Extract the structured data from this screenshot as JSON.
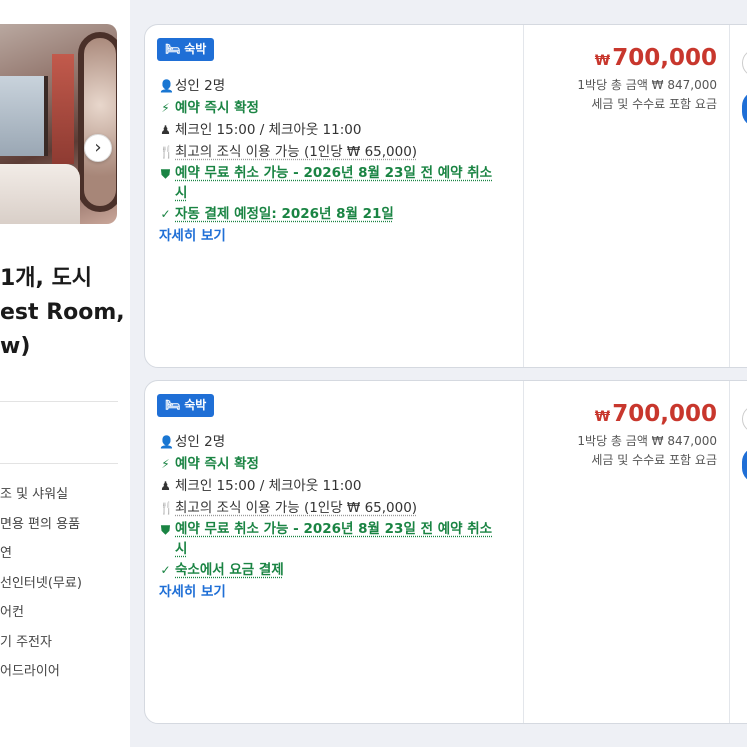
{
  "room": {
    "title_lines": [
      "1개, 도시",
      "est Room,",
      "w)"
    ],
    "amenities": [
      "조 및 샤워실",
      "면용 편의 용품",
      "연",
      "선인터넷(무료)",
      "어컨",
      "기 주전자",
      "어드라이어"
    ],
    "next_glyph": "›"
  },
  "offers": [
    {
      "badge": "숙박",
      "guests": "성인 2명",
      "instant": "예약 즉시 확정",
      "checkin": "체크인 15:00 / 체크아웃 11:00",
      "breakfast": "최고의 조식 이용 가능 (1인당 ₩ 65,000)",
      "cancel": "예약 무료 취소 가능 - 2026년 8월 23일 전 예약 취소 시",
      "payment": "자동 결제 예정일: 2026년 8월 21일",
      "details": "자세히 보기",
      "price_symbol": "₩",
      "price": "700,000",
      "total": "1박당 총 금액 ₩ 847,000",
      "tax_note": "세금 및 수수료 포함 요금"
    },
    {
      "badge": "숙박",
      "guests": "성인 2명",
      "instant": "예약 즉시 확정",
      "checkin": "체크인 15:00 / 체크아웃 11:00",
      "breakfast": "최고의 조식 이용 가능 (1인당 ₩ 65,000)",
      "cancel": "예약 무료 취소 가능 - 2026년 8월 23일 전 예약 취소 시",
      "payment": "숙소에서 요금 결제",
      "details": "자세히 보기",
      "price_symbol": "₩",
      "price": "700,000",
      "total": "1박당 총 금액 ₩ 847,000",
      "tax_note": "세금 및 수수료 포함 요금"
    }
  ],
  "icons": {
    "person": "person-icon",
    "bolt": "bolt-icon",
    "checkin": "checkin-icon",
    "cutlery": "cutlery-icon",
    "shield": "shield-check-icon",
    "check": "check-icon",
    "bed": "bed-icon"
  },
  "colors": {
    "accent": "#1f6fd6",
    "price": "#c8372d",
    "success": "#1a8443"
  }
}
